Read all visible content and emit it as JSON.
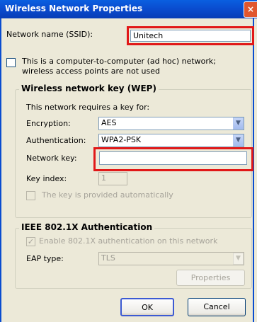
{
  "window": {
    "title": "Wireless Network Properties",
    "close_glyph": "×"
  },
  "ssid": {
    "label": "Network name (SSID):",
    "value": "Unitech"
  },
  "adhoc": {
    "line1": "This is a computer-to-computer (ad hoc) network;",
    "line2": "wireless access points are not used"
  },
  "wep": {
    "group_title": "Wireless network key (WEP)",
    "intro": "This network requires a key for:",
    "encryption": {
      "label": "Encryption:",
      "value": "AES"
    },
    "authentication": {
      "label": "Authentication:",
      "value": "WPA2-PSK"
    },
    "network_key": {
      "label": "Network key:",
      "value": ""
    },
    "key_index": {
      "label": "Key index:",
      "value": "1"
    },
    "auto_key": {
      "label": "The key is provided automatically"
    }
  },
  "ieee": {
    "group_title": "IEEE 802.1X Authentication",
    "enable": {
      "label": "Enable 802.1X authentication on this network"
    },
    "eap": {
      "label": "EAP type:",
      "value": "TLS"
    },
    "properties_button": "Properties"
  },
  "buttons": {
    "ok": "OK",
    "cancel": "Cancel"
  },
  "colors": {
    "title_bar": "#0a4dd0",
    "highlight": "#e11818",
    "dialog_bg": "#ece9d8"
  }
}
